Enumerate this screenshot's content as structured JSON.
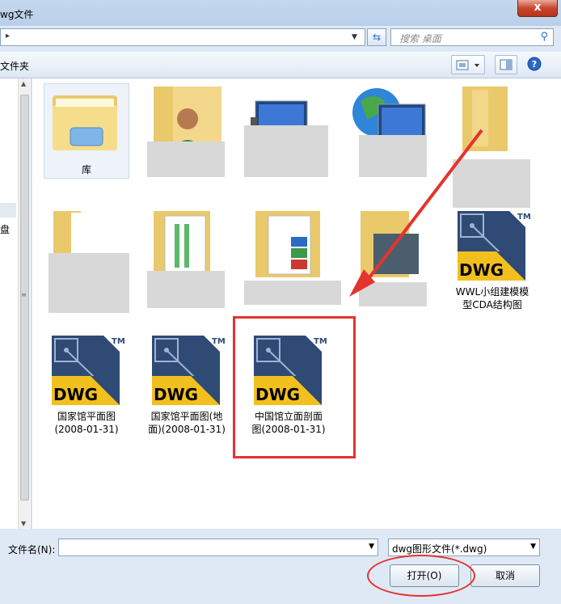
{
  "window": {
    "title": "wg文件",
    "close_glyph": "x"
  },
  "address": {
    "path_arrow": "▸"
  },
  "search": {
    "placeholder": "搜索 桌面"
  },
  "toolbar": {
    "new_folder": "文件夹"
  },
  "nav": {
    "partial_label": "盘"
  },
  "items": [
    {
      "label": "库"
    },
    {
      "label": ""
    },
    {
      "label": ""
    },
    {
      "label": ""
    },
    {
      "label": ""
    },
    {
      "label": ""
    },
    {
      "label": ""
    },
    {
      "label": ""
    },
    {
      "label": ""
    },
    {
      "label": "WWL小组建模模型CDA结构图"
    },
    {
      "label": "国家馆平面图(2008-01-31)"
    },
    {
      "label": "国家馆平面图(地面)(2008-01-31)"
    },
    {
      "label": "中国馆立面剖面图(2008-01-31)"
    }
  ],
  "dwg": {
    "text": "DWG",
    "tm": "TM"
  },
  "labels": {
    "wwl_line1": "WWL小组建模模",
    "wwl_line2": "型CDA结构图",
    "guojia1_line1": "国家馆平面图",
    "guojia1_line2": "(2008-01-31)",
    "guojia2_line1": "国家馆平面图(地",
    "guojia2_line2": "面)(2008-01-31)",
    "zhongguo_line1": "中国馆立面剖面",
    "zhongguo_line2": "图(2008-01-31)"
  },
  "bottom": {
    "filename_label": "文件名(N):",
    "filename_value": "",
    "filetype": "dwg图形文件(*.dwg)",
    "open_button": "打开(O)",
    "cancel_button": "取消"
  },
  "colors": {
    "annotation_red": "#e5332f",
    "dwg_yellow": "#f2c01e",
    "dwg_navy": "#2e4a75"
  }
}
